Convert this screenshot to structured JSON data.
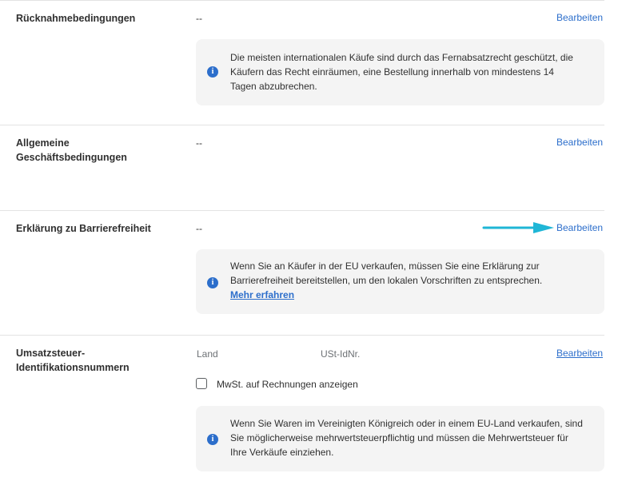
{
  "returns": {
    "label": "Rücknahmebedingungen",
    "value": "--",
    "edit": "Bearbeiten",
    "info": "Die meisten internationalen Käufe sind durch das Fernabsatzrecht geschützt, die Käufern das Recht einräumen, eine Bestellung innerhalb von mindestens 14 Tagen abzubrechen."
  },
  "terms": {
    "label_line1": "Allgemeine",
    "label_line2": "Geschäftsbedingungen",
    "value": "--",
    "edit": "Bearbeiten"
  },
  "accessibility": {
    "label": "Erklärung zu Barrierefreiheit",
    "value": "--",
    "edit": "Bearbeiten",
    "info": "Wenn Sie an Käufer in der EU verkaufen, müssen Sie eine Erklärung zur Barrierefreiheit bereitstellen, um den lokalen Vorschriften zu entsprechen.",
    "info_link": "Mehr erfahren"
  },
  "vat": {
    "label_line1": "Umsatzsteuer-",
    "label_line2": "Identifikationsnummern",
    "col_country": "Land",
    "col_vatid": "USt-IdNr.",
    "edit": "Bearbeiten",
    "checkbox_label": "MwSt. auf Rechnungen anzeigen",
    "checkbox_checked": false,
    "info": "Wenn Sie Waren im Vereinigten Königreich oder in einem EU-Land verkaufen, sind Sie möglicherweise mehrwertsteuerpflichtig und müssen die Mehrwertsteuer für Ihre Verkäufe einziehen."
  },
  "colors": {
    "accent": "#2c6ecb",
    "arrow": "#1fb6d6",
    "info_bg": "#f4f4f4"
  },
  "icons": {
    "info": "info-icon",
    "arrow": "arrow-right-icon"
  }
}
